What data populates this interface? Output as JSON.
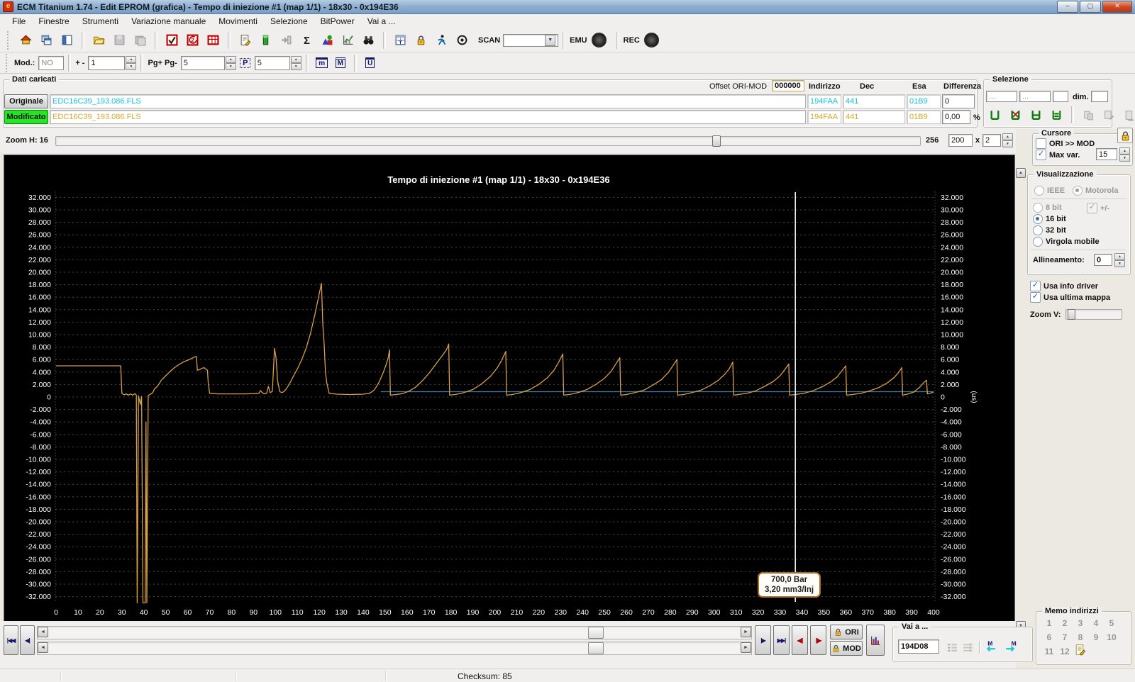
{
  "window": {
    "title": "ECM Titanium 1.74 - Edit EPROM (grafica) - Tempo di iniezione #1 (map 1/1) - 18x30 - 0x194E36",
    "buttons": {
      "minimize": "–",
      "maximize": "▢",
      "close": "✕"
    },
    "icon_letter": "e"
  },
  "menu": [
    "File",
    "Finestre",
    "Strumenti",
    "Variazione manuale",
    "Movimenti",
    "Selezione",
    "BitPower",
    "Vai a ..."
  ],
  "toolbar": {
    "groups": [
      [
        "home-icon",
        "cascade-windows-icon",
        "tile-window-icon"
      ],
      [
        "open-file-icon",
        "save-icon",
        "save-all-icon"
      ],
      [
        "checksum-ok-icon",
        "checksum-2-icon",
        "table-red-icon"
      ],
      [
        "driver-info-icon",
        "column-green-icon",
        "import-icon",
        "sum-sigma-icon",
        "shapes-icon",
        "chart-wizard-icon",
        "search-binoculars-icon"
      ]
    ],
    "right_icons": [
      "table-window-icon",
      "lock-icon",
      "driver-man-icon",
      "target-icon"
    ],
    "scan_label": "SCAN",
    "emu_label": "EMU",
    "rec_label": "REC"
  },
  "toolbar2": {
    "mod_label": "Mod.:",
    "mod_value": "NO",
    "plusminus_label": "+ -",
    "plusminus_value": "1",
    "pg_label": "Pg+ Pg-",
    "pg_value": "5",
    "p_button": "P",
    "p_value": "5",
    "m_button": "m",
    "M_button": "M",
    "U_button": "U"
  },
  "dati": {
    "group_label": "Dati caricati",
    "offset_label": "Offset ORI-MOD",
    "offset_value": "000000",
    "col_indirizzo": "Indirizzo",
    "col_dec": "Dec",
    "col_esa": "Esa",
    "col_diff": "Differenza",
    "originale": {
      "label": "Originale",
      "file": "EDC16C39_193.086.FLS",
      "indirizzo": "194FAA",
      "dec": "441",
      "esa": "01B9",
      "diff": "0"
    },
    "modificato": {
      "label": "Modificato",
      "file": "EDC16C39_193.086.FLS",
      "indirizzo": "194FAA",
      "dec": "441",
      "esa": "01B9",
      "diff": "0,00",
      "percent": "%"
    }
  },
  "selezione": {
    "group_label": "Selezione",
    "field1": "...",
    "field2": "...",
    "dim_label": "dim.",
    "icons_green": [
      "select-open-icon",
      "select-cross-icon",
      "select-h-icon",
      "select-rows-icon"
    ],
    "icons_gray": [
      "paste-map-icon",
      "copy-map-icon",
      "apply-map-icon"
    ],
    "icon_red": "refresh-red-icon"
  },
  "zoomh": {
    "label": "Zoom H: 16",
    "value1": "256",
    "value2": "200",
    "x_label": "x",
    "value3": "2"
  },
  "cursore": {
    "group_label": "Cursore",
    "ori_mod_label": "ORI >> MOD",
    "ori_mod_checked": false,
    "maxvar_label": "Max var.",
    "maxvar_checked": true,
    "maxvar_value": "15"
  },
  "visualizzazione": {
    "group_label": "Visualizzazione",
    "radio_ieee": "IEEE",
    "radio_motorola": "Motorola",
    "radio_8bit": "8 bit",
    "plusminus_label": "+/-",
    "radio_16bit": "16 bit",
    "radio_32bit": "32 bit",
    "radio_virgola": "Virgola mobile",
    "allineamento_label": "Allineamento:",
    "allineamento_value": "0",
    "usa_info_label": "Usa info driver",
    "usa_mappa_label": "Usa ultima mappa",
    "zoomv_label": "Zoom V:"
  },
  "memo": {
    "group_label": "Memo indirizzi",
    "numbers": [
      "1",
      "2",
      "3",
      "4",
      "5",
      "6",
      "7",
      "8",
      "9",
      "10",
      "11",
      "12"
    ],
    "note_icon": "memo-note-icon"
  },
  "bottomnav": {
    "first_btn": "|◀◀",
    "prev_btn": "◀|",
    "step_fwd": "|▶",
    "last_btn": "▶▶|",
    "cmp_back": "◀||",
    "cmp_fwd": "||▶",
    "ori_label": "ORI",
    "mod_label": "MOD",
    "vai_label": "Vai a ...",
    "vai_value": "194D08"
  },
  "statusbar": {
    "checksum": "Checksum: 85"
  },
  "chart_data": {
    "type": "line",
    "title": "Tempo di iniezione #1 (map 1/1) - 18x30 - 0x194E36",
    "y_unit_label": "(us)",
    "ylim": [
      -32,
      32
    ],
    "ytick_step": 2,
    "ytick_label_style": "thousands, e.g. 32.000 … 0 … -32.000",
    "xlim": [
      0,
      400
    ],
    "xtick_step": 10,
    "grid": "horizontal dashed lines every 2.000, dotted vertical borders",
    "background": "#000000",
    "cursor": {
      "x": 337,
      "tooltip_line1": "700,0 Bar",
      "tooltip_line2": "3,20 mm3/Inj"
    },
    "series": [
      {
        "name": "modificato",
        "color": "#d8a048",
        "points": [
          [
            0,
            5
          ],
          [
            28,
            5
          ],
          [
            29.5,
            5
          ],
          [
            30,
            0.6
          ],
          [
            31,
            0.35
          ],
          [
            32,
            0.5
          ],
          [
            33,
            0.3
          ],
          [
            34,
            0.5
          ],
          [
            35,
            0.3
          ],
          [
            36,
            0.55
          ],
          [
            36.6,
            0.3
          ],
          [
            37,
            -33
          ],
          [
            37.6,
            0.2
          ],
          [
            38.4,
            -1.2
          ],
          [
            39,
            0.1
          ],
          [
            39.6,
            -33
          ],
          [
            40.6,
            -33
          ],
          [
            41,
            -4
          ],
          [
            41.4,
            -33
          ],
          [
            42,
            0.2
          ],
          [
            43,
            0.45
          ],
          [
            44,
            0.65
          ],
          [
            45,
            1.35
          ],
          [
            46,
            1.65
          ],
          [
            47,
            2.1
          ],
          [
            48,
            2.7
          ],
          [
            50,
            3.4
          ],
          [
            52,
            4.1
          ],
          [
            54,
            4.7
          ],
          [
            56,
            5.2
          ],
          [
            58,
            5.6
          ],
          [
            60,
            5.9
          ],
          [
            62,
            6.2
          ],
          [
            63,
            6.4
          ],
          [
            64,
            6.5
          ],
          [
            64.4,
            4.3
          ],
          [
            65.5,
            4.4
          ],
          [
            66.5,
            4.6
          ],
          [
            67.5,
            4.7
          ],
          [
            68.5,
            4.4
          ],
          [
            69,
            4.3
          ],
          [
            69.4,
            2.2
          ],
          [
            70,
            0.6
          ],
          [
            74,
            0.5
          ],
          [
            80,
            0.5
          ],
          [
            86,
            0.5
          ],
          [
            91,
            0.55
          ],
          [
            92.5,
            0.6
          ],
          [
            93.2,
            1.05
          ],
          [
            94,
            0.7
          ],
          [
            95,
            0.5
          ],
          [
            96,
            0.6
          ],
          [
            96.8,
            1.7
          ],
          [
            97.6,
            0.7
          ],
          [
            98.6,
            0.9
          ],
          [
            99.6,
            7.8
          ],
          [
            100.3,
            6.2
          ],
          [
            101,
            2.6
          ],
          [
            102,
            0.85
          ],
          [
            103,
            0.7
          ],
          [
            104,
            0.9
          ],
          [
            105,
            1.3
          ],
          [
            106,
            1.9
          ],
          [
            107,
            2.5
          ],
          [
            108,
            3.2
          ],
          [
            110,
            4.5
          ],
          [
            112,
            6
          ],
          [
            114,
            7.8
          ],
          [
            116,
            10.2
          ],
          [
            118,
            13.2
          ],
          [
            120,
            16.6
          ],
          [
            121,
            18.2
          ],
          [
            121.6,
            11.8
          ],
          [
            122.2,
            8.6
          ],
          [
            122.8,
            4
          ],
          [
            123.4,
            2.3
          ],
          [
            124.5,
            0.6
          ],
          [
            128,
            0.45
          ],
          [
            134,
            0.4
          ],
          [
            140,
            0.45
          ],
          [
            143,
            0.6
          ],
          [
            145,
            1.1
          ],
          [
            147,
            2.2
          ],
          [
            149,
            3.8
          ],
          [
            150.5,
            5.2
          ],
          [
            151.5,
            6.4
          ],
          [
            152,
            7.6
          ],
          [
            152.4,
            0.3
          ],
          [
            155,
            0.4
          ],
          [
            158,
            0.55
          ],
          [
            161,
            0.95
          ],
          [
            164,
            1.6
          ],
          [
            167,
            2.6
          ],
          [
            170,
            3.8
          ],
          [
            173,
            5.2
          ],
          [
            176,
            6.6
          ],
          [
            178,
            7.6
          ],
          [
            179,
            8.5
          ],
          [
            179.4,
            0.3
          ],
          [
            182,
            0.4
          ],
          [
            186,
            0.7
          ],
          [
            190,
            1.2
          ],
          [
            194,
            2.1
          ],
          [
            198,
            3.3
          ],
          [
            201,
            4.6
          ],
          [
            203,
            5.8
          ],
          [
            205,
            7.3
          ],
          [
            205.4,
            0.3
          ],
          [
            208,
            0.4
          ],
          [
            212,
            0.7
          ],
          [
            216,
            1.2
          ],
          [
            220,
            2
          ],
          [
            224,
            3.1
          ],
          [
            227,
            4.3
          ],
          [
            229,
            5.5
          ],
          [
            231,
            6.9
          ],
          [
            231.4,
            0.3
          ],
          [
            234,
            0.4
          ],
          [
            238,
            0.7
          ],
          [
            242,
            1.2
          ],
          [
            246,
            2
          ],
          [
            250,
            3
          ],
          [
            253,
            4.1
          ],
          [
            255,
            5.2
          ],
          [
            257,
            6.3
          ],
          [
            257.4,
            0.3
          ],
          [
            260,
            0.4
          ],
          [
            264,
            0.7
          ],
          [
            268,
            1.1
          ],
          [
            272,
            1.9
          ],
          [
            276,
            2.8
          ],
          [
            279,
            3.9
          ],
          [
            281,
            4.9
          ],
          [
            283,
            6
          ],
          [
            283.4,
            0.3
          ],
          [
            286,
            0.4
          ],
          [
            290,
            0.7
          ],
          [
            294,
            1.1
          ],
          [
            298,
            1.8
          ],
          [
            302,
            2.7
          ],
          [
            305,
            3.7
          ],
          [
            307,
            4.6
          ],
          [
            308.5,
            5.6
          ],
          [
            308.9,
            0.3
          ],
          [
            311,
            0.4
          ],
          [
            315,
            0.6
          ],
          [
            319,
            1
          ],
          [
            323,
            1.7
          ],
          [
            327,
            2.5
          ],
          [
            330,
            3.4
          ],
          [
            332,
            4.3
          ],
          [
            334,
            5.3
          ],
          [
            334.4,
            0.3
          ],
          [
            337,
            0.4
          ],
          [
            341,
            0.6
          ],
          [
            345,
            1
          ],
          [
            349,
            1.6
          ],
          [
            353,
            2.4
          ],
          [
            356,
            3.2
          ],
          [
            358,
            4.1
          ],
          [
            360,
            5
          ],
          [
            360.4,
            0.3
          ],
          [
            363,
            0.4
          ],
          [
            367,
            0.6
          ],
          [
            371,
            1
          ],
          [
            375,
            1.5
          ],
          [
            379,
            2.3
          ],
          [
            382,
            3.1
          ],
          [
            384,
            3.9
          ],
          [
            385.5,
            4.7
          ],
          [
            385.9,
            0.3
          ],
          [
            388,
            0.45
          ],
          [
            391,
            0.8
          ],
          [
            393.5,
            1.5
          ],
          [
            395.5,
            2.3
          ],
          [
            396.8,
            2.7
          ],
          [
            397.2,
            0.5
          ],
          [
            398.5,
            0.6
          ],
          [
            400,
            0.8
          ]
        ]
      },
      {
        "name": "originale",
        "color": "#3f7fae",
        "points": [
          [
            148,
            0.85
          ],
          [
            400,
            0.85
          ]
        ]
      }
    ]
  }
}
